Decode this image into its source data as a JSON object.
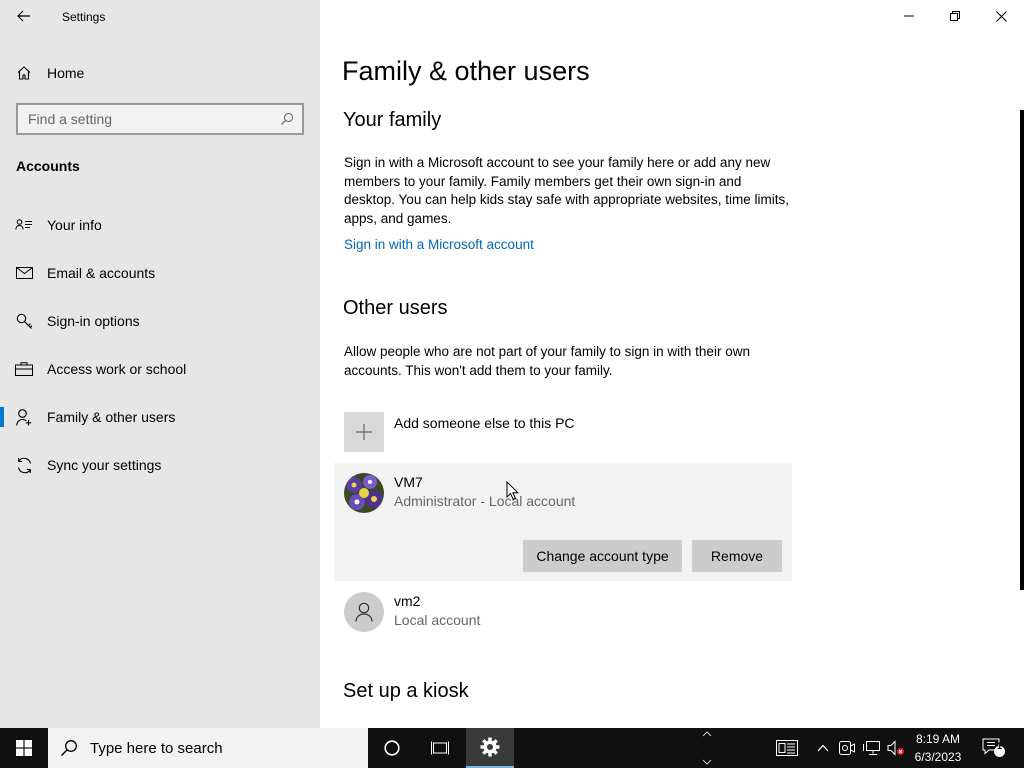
{
  "window": {
    "title": "Settings"
  },
  "sidebar": {
    "home_label": "Home",
    "search_placeholder": "Find a setting",
    "section_heading": "Accounts",
    "items": [
      {
        "label": "Your info",
        "icon": "contact-card-icon"
      },
      {
        "label": "Email & accounts",
        "icon": "mail-icon"
      },
      {
        "label": "Sign-in options",
        "icon": "key-icon"
      },
      {
        "label": "Access work or school",
        "icon": "briefcase-icon"
      },
      {
        "label": "Family & other users",
        "icon": "person-add-icon",
        "active": true
      },
      {
        "label": "Sync your settings",
        "icon": "sync-icon"
      }
    ]
  },
  "main": {
    "page_title": "Family & other users",
    "your_family": {
      "heading": "Your family",
      "description": "Sign in with a Microsoft account to see your family here or add any new members to your family. Family members get their own sign-in and desktop. You can help kids stay safe with appropriate websites, time limits, apps, and games.",
      "link": "Sign in with a Microsoft account"
    },
    "other_users": {
      "heading": "Other users",
      "description": "Allow people who are not part of your family to sign in with their own accounts. This won't add them to your family.",
      "add_label": "Add someone else to this PC",
      "users": [
        {
          "name": "VM7",
          "type": "Administrator - Local account",
          "selected": true
        },
        {
          "name": "vm2",
          "type": "Local account"
        }
      ],
      "change_type_label": "Change account type",
      "remove_label": "Remove"
    },
    "kiosk_heading": "Set up a kiosk"
  },
  "taskbar": {
    "search_placeholder": "Type here to search",
    "time": "8:19 AM",
    "date": "6/3/2023",
    "notification_count": "1"
  },
  "colors": {
    "accent": "#0078d7",
    "link": "#0067b8",
    "sidebar_bg": "#e6e6e6",
    "taskbar_bg": "#101010"
  }
}
